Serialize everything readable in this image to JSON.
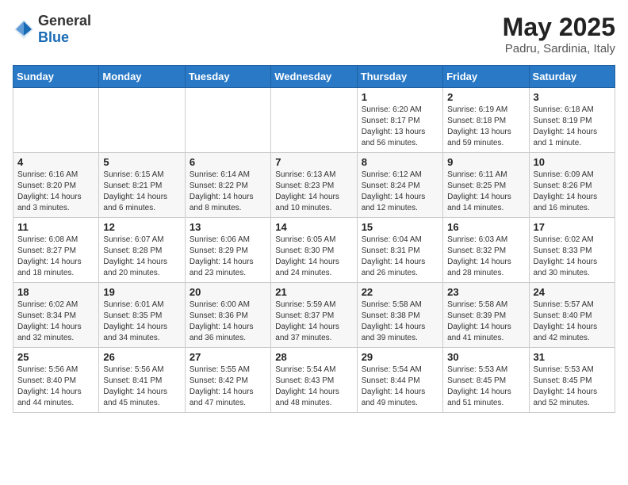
{
  "header": {
    "logo_general": "General",
    "logo_blue": "Blue",
    "month_year": "May 2025",
    "location": "Padru, Sardinia, Italy"
  },
  "days_of_week": [
    "Sunday",
    "Monday",
    "Tuesday",
    "Wednesday",
    "Thursday",
    "Friday",
    "Saturday"
  ],
  "weeks": [
    [
      {
        "day": "",
        "info": ""
      },
      {
        "day": "",
        "info": ""
      },
      {
        "day": "",
        "info": ""
      },
      {
        "day": "",
        "info": ""
      },
      {
        "day": "1",
        "info": "Sunrise: 6:20 AM\nSunset: 8:17 PM\nDaylight: 13 hours\nand 56 minutes."
      },
      {
        "day": "2",
        "info": "Sunrise: 6:19 AM\nSunset: 8:18 PM\nDaylight: 13 hours\nand 59 minutes."
      },
      {
        "day": "3",
        "info": "Sunrise: 6:18 AM\nSunset: 8:19 PM\nDaylight: 14 hours\nand 1 minute."
      }
    ],
    [
      {
        "day": "4",
        "info": "Sunrise: 6:16 AM\nSunset: 8:20 PM\nDaylight: 14 hours\nand 3 minutes."
      },
      {
        "day": "5",
        "info": "Sunrise: 6:15 AM\nSunset: 8:21 PM\nDaylight: 14 hours\nand 6 minutes."
      },
      {
        "day": "6",
        "info": "Sunrise: 6:14 AM\nSunset: 8:22 PM\nDaylight: 14 hours\nand 8 minutes."
      },
      {
        "day": "7",
        "info": "Sunrise: 6:13 AM\nSunset: 8:23 PM\nDaylight: 14 hours\nand 10 minutes."
      },
      {
        "day": "8",
        "info": "Sunrise: 6:12 AM\nSunset: 8:24 PM\nDaylight: 14 hours\nand 12 minutes."
      },
      {
        "day": "9",
        "info": "Sunrise: 6:11 AM\nSunset: 8:25 PM\nDaylight: 14 hours\nand 14 minutes."
      },
      {
        "day": "10",
        "info": "Sunrise: 6:09 AM\nSunset: 8:26 PM\nDaylight: 14 hours\nand 16 minutes."
      }
    ],
    [
      {
        "day": "11",
        "info": "Sunrise: 6:08 AM\nSunset: 8:27 PM\nDaylight: 14 hours\nand 18 minutes."
      },
      {
        "day": "12",
        "info": "Sunrise: 6:07 AM\nSunset: 8:28 PM\nDaylight: 14 hours\nand 20 minutes."
      },
      {
        "day": "13",
        "info": "Sunrise: 6:06 AM\nSunset: 8:29 PM\nDaylight: 14 hours\nand 23 minutes."
      },
      {
        "day": "14",
        "info": "Sunrise: 6:05 AM\nSunset: 8:30 PM\nDaylight: 14 hours\nand 24 minutes."
      },
      {
        "day": "15",
        "info": "Sunrise: 6:04 AM\nSunset: 8:31 PM\nDaylight: 14 hours\nand 26 minutes."
      },
      {
        "day": "16",
        "info": "Sunrise: 6:03 AM\nSunset: 8:32 PM\nDaylight: 14 hours\nand 28 minutes."
      },
      {
        "day": "17",
        "info": "Sunrise: 6:02 AM\nSunset: 8:33 PM\nDaylight: 14 hours\nand 30 minutes."
      }
    ],
    [
      {
        "day": "18",
        "info": "Sunrise: 6:02 AM\nSunset: 8:34 PM\nDaylight: 14 hours\nand 32 minutes."
      },
      {
        "day": "19",
        "info": "Sunrise: 6:01 AM\nSunset: 8:35 PM\nDaylight: 14 hours\nand 34 minutes."
      },
      {
        "day": "20",
        "info": "Sunrise: 6:00 AM\nSunset: 8:36 PM\nDaylight: 14 hours\nand 36 minutes."
      },
      {
        "day": "21",
        "info": "Sunrise: 5:59 AM\nSunset: 8:37 PM\nDaylight: 14 hours\nand 37 minutes."
      },
      {
        "day": "22",
        "info": "Sunrise: 5:58 AM\nSunset: 8:38 PM\nDaylight: 14 hours\nand 39 minutes."
      },
      {
        "day": "23",
        "info": "Sunrise: 5:58 AM\nSunset: 8:39 PM\nDaylight: 14 hours\nand 41 minutes."
      },
      {
        "day": "24",
        "info": "Sunrise: 5:57 AM\nSunset: 8:40 PM\nDaylight: 14 hours\nand 42 minutes."
      }
    ],
    [
      {
        "day": "25",
        "info": "Sunrise: 5:56 AM\nSunset: 8:40 PM\nDaylight: 14 hours\nand 44 minutes."
      },
      {
        "day": "26",
        "info": "Sunrise: 5:56 AM\nSunset: 8:41 PM\nDaylight: 14 hours\nand 45 minutes."
      },
      {
        "day": "27",
        "info": "Sunrise: 5:55 AM\nSunset: 8:42 PM\nDaylight: 14 hours\nand 47 minutes."
      },
      {
        "day": "28",
        "info": "Sunrise: 5:54 AM\nSunset: 8:43 PM\nDaylight: 14 hours\nand 48 minutes."
      },
      {
        "day": "29",
        "info": "Sunrise: 5:54 AM\nSunset: 8:44 PM\nDaylight: 14 hours\nand 49 minutes."
      },
      {
        "day": "30",
        "info": "Sunrise: 5:53 AM\nSunset: 8:45 PM\nDaylight: 14 hours\nand 51 minutes."
      },
      {
        "day": "31",
        "info": "Sunrise: 5:53 AM\nSunset: 8:45 PM\nDaylight: 14 hours\nand 52 minutes."
      }
    ]
  ]
}
